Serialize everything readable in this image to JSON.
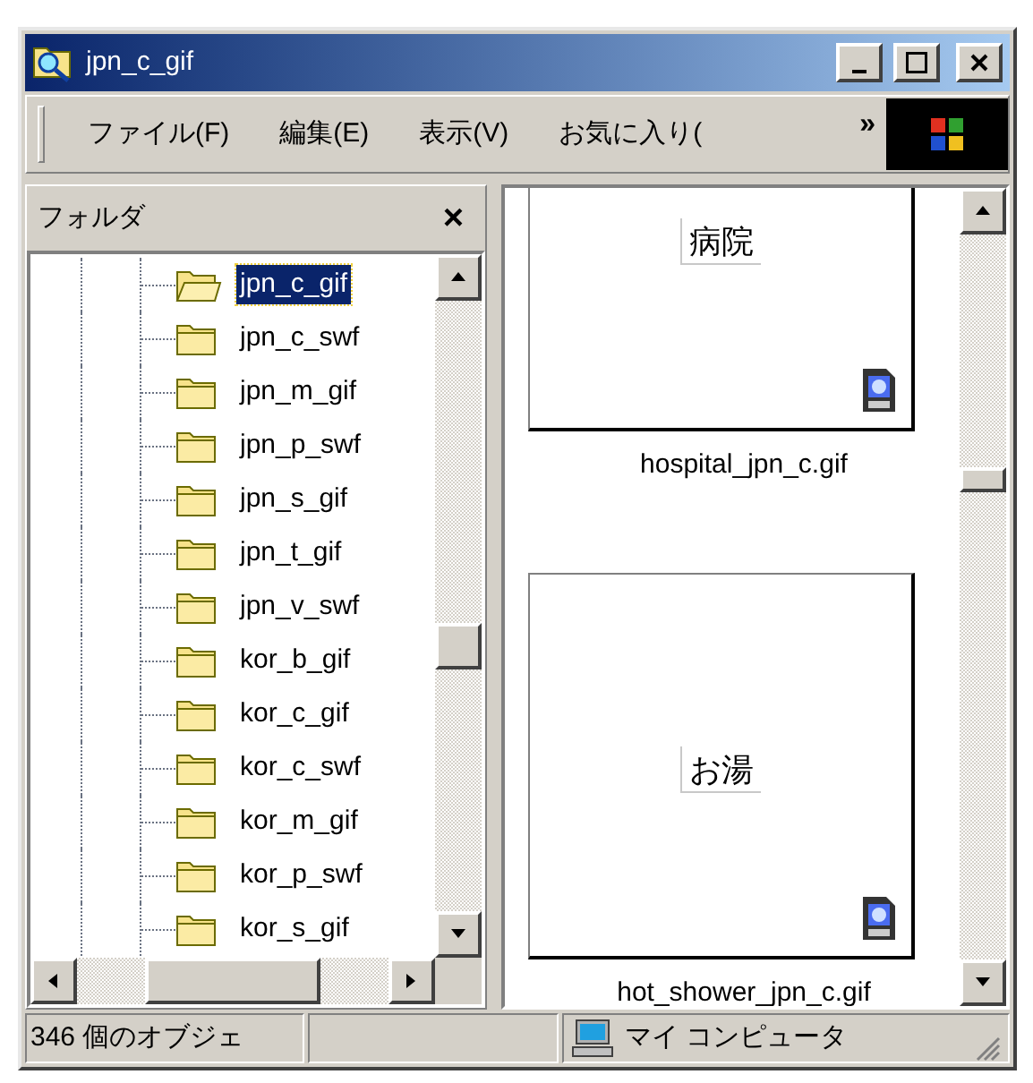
{
  "window": {
    "title": "jpn_c_gif"
  },
  "menu": {
    "items": [
      "ファイル(F)",
      "編集(E)",
      "表示(V)",
      "お気に入り("
    ],
    "overflow": "»"
  },
  "folder_pane": {
    "title": "フォルダ",
    "close": "×",
    "items": [
      {
        "label": "jpn_c_gif",
        "selected": true
      },
      {
        "label": "jpn_c_swf",
        "selected": false
      },
      {
        "label": "jpn_m_gif",
        "selected": false
      },
      {
        "label": "jpn_p_swf",
        "selected": false
      },
      {
        "label": "jpn_s_gif",
        "selected": false
      },
      {
        "label": "jpn_t_gif",
        "selected": false
      },
      {
        "label": "jpn_v_swf",
        "selected": false
      },
      {
        "label": "kor_b_gif",
        "selected": false
      },
      {
        "label": "kor_c_gif",
        "selected": false
      },
      {
        "label": "kor_c_swf",
        "selected": false
      },
      {
        "label": "kor_m_gif",
        "selected": false
      },
      {
        "label": "kor_p_swf",
        "selected": false
      },
      {
        "label": "kor_s_gif",
        "selected": false
      }
    ]
  },
  "files": [
    {
      "name": "hospital_jpn_c.gif",
      "image_text": "病院"
    },
    {
      "name": "hot_shower_jpn_c.gif",
      "image_text": "お湯"
    }
  ],
  "status_bar": {
    "count": "346 個のオブジェ",
    "location": "マイ コンピュータ"
  }
}
